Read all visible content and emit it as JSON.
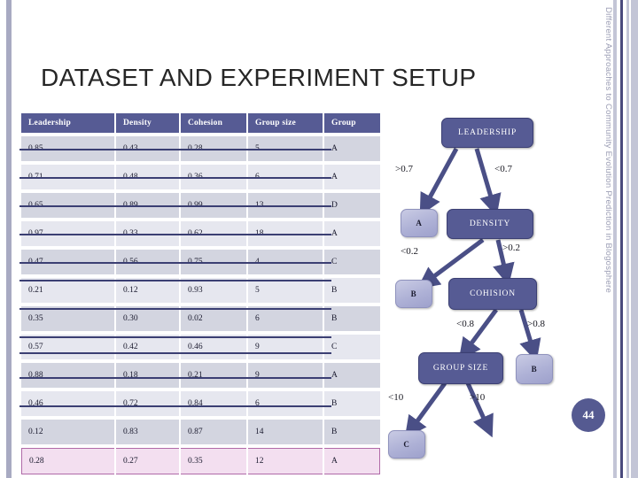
{
  "slide": {
    "title": "DATASET AND EXPERIMENT SETUP",
    "running_title": "Different Approaches to Community Evolution Prediction in Blogosphere",
    "page_number": "44",
    "accent_color": "#565b94",
    "leaf_color": "#aeb1d6",
    "highlight_row_color": "#f3dff0"
  },
  "table": {
    "headers": [
      "Leadership",
      "Density",
      "Cohesion",
      "Group size",
      "Group"
    ],
    "rows": [
      {
        "leadership": "0.85",
        "density": "0.43",
        "cohesion": "0.28",
        "group_size": "5",
        "group": "A"
      },
      {
        "leadership": "0.71",
        "density": "0.48",
        "cohesion": "0.36",
        "group_size": "6",
        "group": "A"
      },
      {
        "leadership": "0.65",
        "density": "0.89",
        "cohesion": "0.99",
        "group_size": "13",
        "group": "D"
      },
      {
        "leadership": "0.97",
        "density": "0.33",
        "cohesion": "0.62",
        "group_size": "18",
        "group": "A"
      },
      {
        "leadership": "0.47",
        "density": "0.56",
        "cohesion": "0.75",
        "group_size": "4",
        "group": "C"
      },
      {
        "leadership": "0.21",
        "density": "0.12",
        "cohesion": "0.93",
        "group_size": "5",
        "group": "B"
      },
      {
        "leadership": "0.35",
        "density": "0.30",
        "cohesion": "0.02",
        "group_size": "6",
        "group": "B"
      },
      {
        "leadership": "0.57",
        "density": "0.42",
        "cohesion": "0.46",
        "group_size": "9",
        "group": "C"
      },
      {
        "leadership": "0.88",
        "density": "0.18",
        "cohesion": "0.21",
        "group_size": "9",
        "group": "A"
      },
      {
        "leadership": "0.46",
        "density": "0.72",
        "cohesion": "0.84",
        "group_size": "6",
        "group": "B"
      },
      {
        "leadership": "0.12",
        "density": "0.83",
        "cohesion": "0.87",
        "group_size": "14",
        "group": "B"
      },
      {
        "leadership": "0.28",
        "density": "0.27",
        "cohesion": "0.35",
        "group_size": "12",
        "group": "A"
      }
    ],
    "selected_row_index": 11
  },
  "tree": {
    "nodes": {
      "root": "LEADERSHIP",
      "density": "DENSITY",
      "cohesion": "COHISION",
      "group_size": "GROUP SIZE",
      "leaf_a": "A",
      "leaf_b1": "B",
      "leaf_b2": "B",
      "leaf_c": "C"
    },
    "edges": {
      "leadership_left": ">0.7",
      "leadership_right": "<0.7",
      "density_left": "<0.2",
      "density_right": ">0.2",
      "cohesion_left": "<0.8",
      "cohesion_right": ">0.8",
      "groupsize_left": "<10",
      "groupsize_right": ">10"
    }
  }
}
